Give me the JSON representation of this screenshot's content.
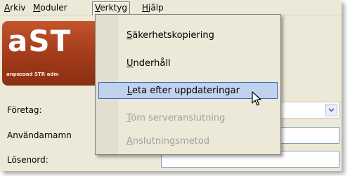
{
  "menubar": {
    "items": [
      {
        "label": "Arkiv",
        "u": "A"
      },
      {
        "label": "Moduler",
        "u": "M"
      },
      {
        "label": "Verktyg",
        "u": "V"
      },
      {
        "label": "Hjälp",
        "u": "H"
      }
    ]
  },
  "logo": {
    "text": "aST",
    "subtitle": "anpassad STR adm"
  },
  "form": {
    "company_label": "Företag:",
    "username_label": "Användarnamn",
    "password_label": "Lösenord:"
  },
  "tools_menu": {
    "items": [
      {
        "label": "Säkerhetskopiering",
        "underline": "S",
        "rest": "äkerhetskopiering",
        "disabled": false
      },
      {
        "label": "Underhåll",
        "underline": "U",
        "rest": "nderhåll",
        "disabled": false
      },
      {
        "label": "Leta efter uppdateringar",
        "underline": "L",
        "rest": "eta efter uppdateringar",
        "disabled": false,
        "hovered": true
      },
      {
        "label": "Töm serveranslutning",
        "underline": "T",
        "rest": "öm serveranslutning",
        "disabled": true
      },
      {
        "label": "Anslutningsmetod",
        "underline": "A",
        "rest": "nslutningsmetod",
        "disabled": true
      }
    ]
  },
  "colors": {
    "highlight": "#c1d2ee",
    "highlight_border": "#316ac5",
    "logo": "#a13a1a"
  },
  "cursor": "arrow-pointer-icon"
}
